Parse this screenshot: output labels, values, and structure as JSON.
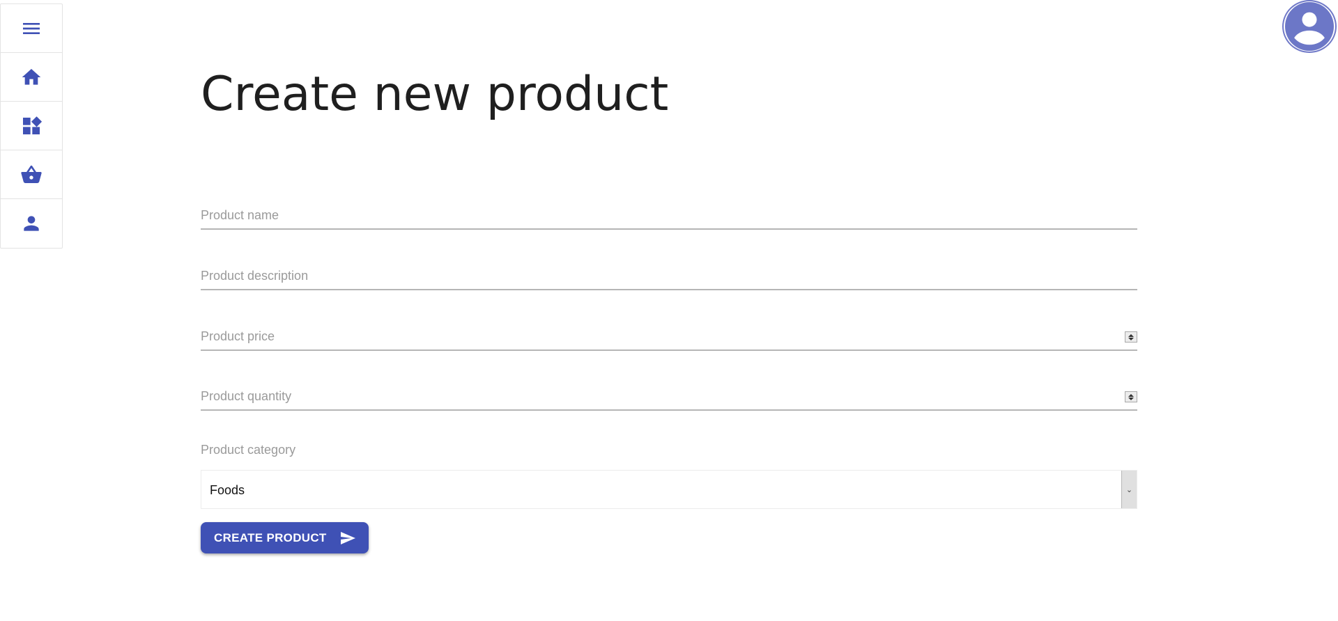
{
  "sidebar": {
    "items": [
      {
        "icon": "menu-icon"
      },
      {
        "icon": "home-icon"
      },
      {
        "icon": "category-icon"
      },
      {
        "icon": "basket-icon"
      },
      {
        "icon": "person-icon"
      }
    ]
  },
  "header": {
    "avatar_icon": "account-circle-icon"
  },
  "main": {
    "title": "Create new product",
    "fields": {
      "name": {
        "placeholder": "Product name",
        "value": ""
      },
      "description": {
        "placeholder": "Product description",
        "value": ""
      },
      "price": {
        "placeholder": "Product price",
        "value": ""
      },
      "quantity": {
        "placeholder": "Product quantity",
        "value": ""
      }
    },
    "category": {
      "label": "Product category",
      "selected": "Foods"
    },
    "submit_label": "CREATE PRODUCT"
  },
  "colors": {
    "accent": "#3f51b5",
    "avatar": "#6c77c7"
  }
}
